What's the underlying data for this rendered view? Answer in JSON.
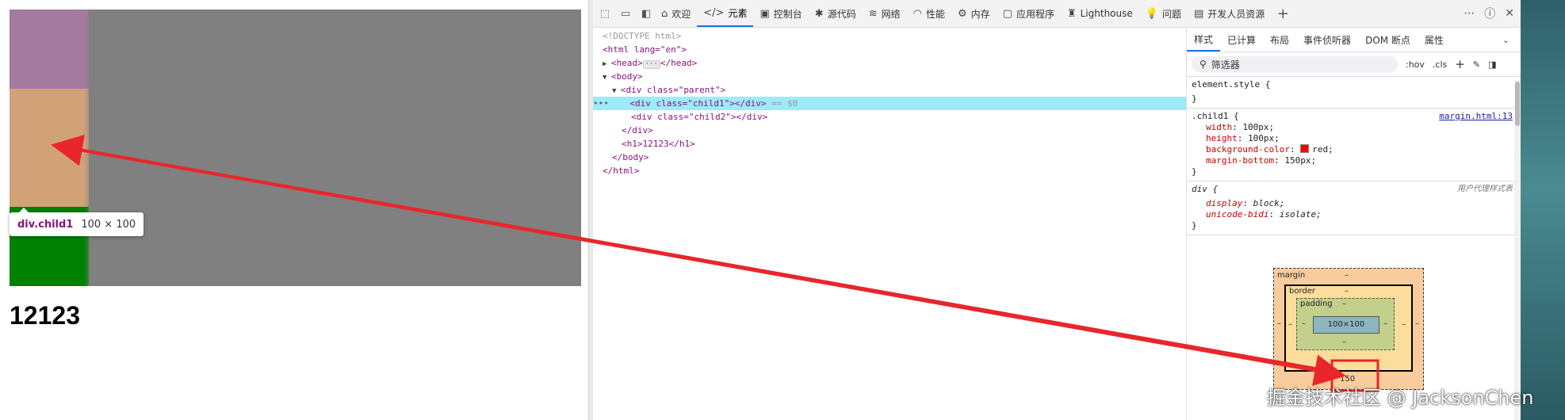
{
  "preview": {
    "heading": "12123",
    "tooltip": {
      "selector": "div.child1",
      "size": "100 × 100"
    }
  },
  "toolbar": {
    "tabs": [
      {
        "label": "欢迎",
        "icon": "home-icon"
      },
      {
        "label": "元素",
        "icon": "code-icon"
      },
      {
        "label": "控制台",
        "icon": "console-icon"
      },
      {
        "label": "源代码",
        "icon": "bug-icon"
      },
      {
        "label": "网络",
        "icon": "wifi-icon"
      },
      {
        "label": "性能",
        "icon": "gauge-icon"
      },
      {
        "label": "内存",
        "icon": "memory-chip-icon"
      },
      {
        "label": "应用程序",
        "icon": "application-icon"
      },
      {
        "label": "Lighthouse",
        "icon": "lighthouse-icon"
      },
      {
        "label": "问题",
        "icon": "lightbulb-icon"
      },
      {
        "label": "开发人员资源",
        "icon": "developer-resources-icon"
      }
    ],
    "active_tab": "元素"
  },
  "dom_tree": {
    "doctype": "<!DOCTYPE html>",
    "html_open": "<html lang=\"en\">",
    "head": "<head>",
    "head_close": "</head>",
    "body_open": "<body>",
    "parent_open": "<div class=\"parent\">",
    "child1": "<div class=\"child1\"></div>",
    "selected_marker": "== $0",
    "child2": "<div class=\"child2\"></div>",
    "div_close": "</div>",
    "h1": "<h1>12123</h1>",
    "body_close": "</body>",
    "html_close": "</html>"
  },
  "styles_pane": {
    "tabs": [
      "样式",
      "已计算",
      "布局",
      "事件侦听器",
      "DOM 断点",
      "属性"
    ],
    "filter_placeholder": "筛选器",
    "hov": ":hov",
    "cls": ".cls",
    "element_style": "element.style {",
    "close_brace": "}",
    "rule1": {
      "selector": ".child1 {",
      "source": "margin.html:13",
      "props": [
        {
          "name": "width",
          "value": "100px;"
        },
        {
          "name": "height",
          "value": "100px;"
        },
        {
          "name": "background-color",
          "value": "red;"
        },
        {
          "name": "margin-bottom",
          "value": "150px;"
        }
      ]
    },
    "rule2": {
      "selector": "div {",
      "source": "用户代理样式表",
      "props": [
        {
          "name": "display",
          "value": "block;"
        },
        {
          "name": "unicode-bidi",
          "value": "isolate;"
        }
      ]
    },
    "box_model": {
      "margin_label": "margin",
      "border_label": "border",
      "padding_label": "padding",
      "content": "100×100",
      "dash": "–",
      "margin_bottom": "150"
    }
  },
  "watermark": "掘金技术社区 @ JacksonChen",
  "colors": {
    "arrow": "#e8262b",
    "selected_row": "#9eeaf9",
    "child1_highlight": "#a47aa0",
    "margin_highlight": "#d1a278",
    "parent_bg": "#808080",
    "child2_bg": "#008000"
  }
}
